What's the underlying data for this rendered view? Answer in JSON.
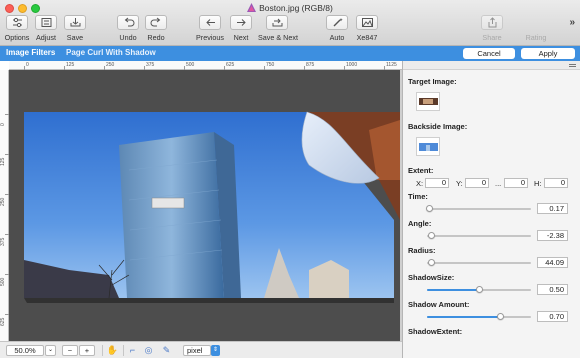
{
  "window": {
    "title": "Boston.jpg (RGB/8)"
  },
  "toolbar": {
    "items": [
      {
        "label": "Options",
        "icon": "options-icon"
      },
      {
        "label": "Adjust",
        "icon": "adjust-icon"
      },
      {
        "label": "Save",
        "icon": "save-icon"
      },
      {
        "label": "Undo",
        "icon": "undo-icon"
      },
      {
        "label": "Redo",
        "icon": "redo-icon"
      },
      {
        "label": "Previous",
        "icon": "arrow-left-icon"
      },
      {
        "label": "Next",
        "icon": "arrow-right-icon"
      },
      {
        "label": "Save & Next",
        "icon": "save-next-icon"
      },
      {
        "label": "Auto",
        "icon": "magic-wand-icon"
      },
      {
        "label": "Xe847",
        "icon": "image-icon"
      },
      {
        "label": "Share",
        "icon": "share-icon",
        "disabled": true
      },
      {
        "label": "Rating",
        "icon": "rating-icon",
        "disabled": true
      }
    ],
    "overflow": "»"
  },
  "filterbar": {
    "section": "Image Filters",
    "filter_name": "Page Curl With Shadow",
    "cancel_label": "Cancel",
    "apply_label": "Apply"
  },
  "rulers": {
    "horizontal": [
      "0",
      "125",
      "250",
      "375",
      "500",
      "625",
      "750",
      "875",
      "1000",
      "1125"
    ],
    "vertical": [
      "0",
      "125",
      "250",
      "375",
      "500",
      "625"
    ]
  },
  "statusbar": {
    "zoom": "50.0%",
    "unit": "pixel",
    "zoom_out": "−",
    "zoom_in": "+"
  },
  "panel": {
    "target_image_label": "Target Image:",
    "backside_image_label": "Backside Image:",
    "extent_label": "Extent:",
    "extent": {
      "x_label": "X:",
      "x": "0",
      "y_label": "Y:",
      "y": "0",
      "w_label": "...",
      "w": "0",
      "h_label": "H:",
      "h": "0"
    },
    "params": [
      {
        "label": "Time:",
        "value": "0.17",
        "fraction": 0.02
      },
      {
        "label": "Angle:",
        "value": "-2.38",
        "fraction": 0.0
      },
      {
        "label": "Radius:",
        "value": "44.09",
        "fraction": 0.0
      },
      {
        "label": "ShadowSize:",
        "value": "0.50",
        "fraction": 0.5
      },
      {
        "label": "Shadow Amount:",
        "value": "0.70",
        "fraction": 0.7
      }
    ],
    "shadow_extent_label": "ShadowExtent:"
  },
  "colors": {
    "accent": "#3d8fe0",
    "canvas_bg": "#4d4d4d"
  }
}
